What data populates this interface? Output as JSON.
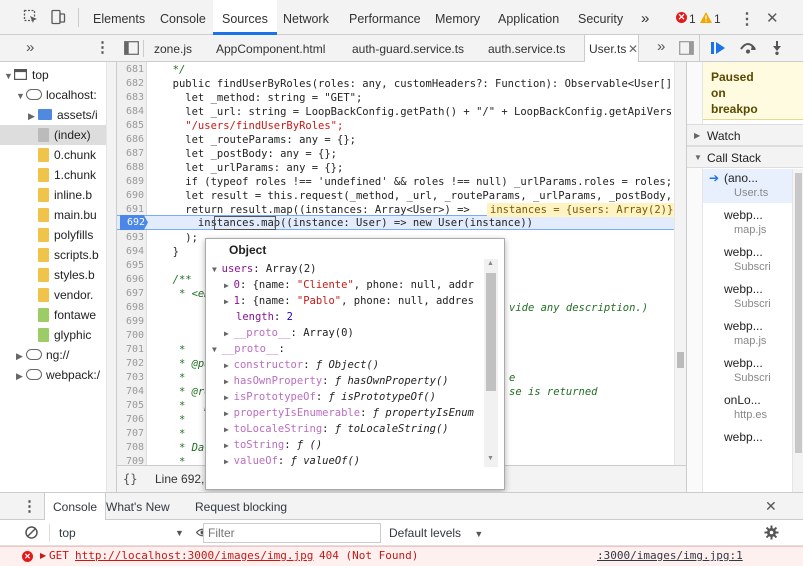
{
  "toolbar": {
    "tabs": [
      "Elements",
      "Console",
      "Sources",
      "Network",
      "Performance",
      "Memory",
      "Application",
      "Security"
    ],
    "more": "»",
    "errors_count": "1",
    "warnings_count": "1",
    "close": "✕"
  },
  "source_tabs": {
    "files": [
      "zone.js",
      "AppComponent.html",
      "auth-guard.service.ts",
      "auth.service.ts",
      "User.ts"
    ],
    "active": "User.ts",
    "nav_more": "»"
  },
  "navigator": {
    "items": [
      {
        "label": "top",
        "icon": "window-icon"
      },
      {
        "label": "localhost:",
        "icon": "cloud-icon"
      },
      {
        "label": "assets/i",
        "icon": "folder-icon"
      },
      {
        "label": "(index)",
        "icon": "file-icon"
      },
      {
        "label": "0.chunk",
        "icon": "file-icon"
      },
      {
        "label": "1.chunk",
        "icon": "file-icon"
      },
      {
        "label": "inline.b",
        "icon": "file-icon"
      },
      {
        "label": "main.bu",
        "icon": "file-icon"
      },
      {
        "label": "polyfills",
        "icon": "file-icon"
      },
      {
        "label": "scripts.b",
        "icon": "file-icon"
      },
      {
        "label": "styles.b",
        "icon": "file-icon"
      },
      {
        "label": "vendor.",
        "icon": "file-icon"
      },
      {
        "label": "fontawe",
        "icon": "file-icon"
      },
      {
        "label": "glyphic",
        "icon": "file-icon"
      },
      {
        "label": "ng://",
        "icon": "cloud-icon"
      },
      {
        "label": "webpack:/",
        "icon": "cloud-icon"
      }
    ]
  },
  "editor": {
    "lines": [
      {
        "num": "681",
        "text": "  */"
      },
      {
        "num": "682",
        "text": "  public findUserByRoles(roles: any, customHeaders?: Function): Observable<User[]"
      },
      {
        "num": "683",
        "text": "    let _method: string = \"GET\";"
      },
      {
        "num": "684",
        "text": "    let _url: string = LoopBackConfig.getPath() + \"/\" + LoopBackConfig.getApiVers"
      },
      {
        "num": "685",
        "text": "    \"/users/findUserByRoles\";"
      },
      {
        "num": "686",
        "text": "    let _routeParams: any = {};"
      },
      {
        "num": "687",
        "text": "    let _postBody: any = {};"
      },
      {
        "num": "688",
        "text": "    let _urlParams: any = {};"
      },
      {
        "num": "689",
        "text": "    if (typeof roles !== 'undefined' && roles !== null) _urlParams.roles = roles;"
      },
      {
        "num": "690",
        "text": "    let result = this.request(_method, _url, _routeParams, _urlParams, _postBody,"
      },
      {
        "num": "691",
        "text": "    return result.map((instances: Array<User>) =>"
      },
      {
        "num": "692",
        "text": "      instances.map((instance: User) => new User(instance))"
      },
      {
        "num": "693",
        "text": "    );"
      },
      {
        "num": "694",
        "text": "  }"
      },
      {
        "num": "695",
        "text": ""
      },
      {
        "num": "696",
        "text": "  /**"
      },
      {
        "num": "697",
        "text": "   * <em"
      },
      {
        "num": "698",
        "text": ""
      },
      {
        "num": "699",
        "text": ""
      },
      {
        "num": "700",
        "text": ""
      },
      {
        "num": "701",
        "text": "   *"
      },
      {
        "num": "702",
        "text": "   * @pa"
      },
      {
        "num": "703",
        "text": "   *"
      },
      {
        "num": "704",
        "text": "   * @re"
      },
      {
        "num": "705",
        "text": "   *   p"
      },
      {
        "num": "706",
        "text": "   *   f"
      },
      {
        "num": "707",
        "text": "   *"
      },
      {
        "num": "708",
        "text": "   * Dat"
      },
      {
        "num": "709",
        "text": "   *"
      }
    ],
    "inline_value": "instances = {users: Array(2)}",
    "comment_tail_698": "vide any description.)",
    "comment_tail_705": "e",
    "comment_tail_706": "se is returned",
    "status": "Line 692, C"
  },
  "popover": {
    "title": "Object",
    "lines": [
      "▼ users: Array(2)",
      "  ▶ 0: {name: \"Cliente\", phone: null, addr",
      "  ▶ 1: {name: \"Pablo\", phone: null, addres",
      "    length: 2",
      "  ▶ __proto__: Array(0)",
      "▼ __proto__:",
      "  ▶ constructor: ƒ Object()",
      "  ▶ hasOwnProperty: ƒ hasOwnProperty()",
      "  ▶ isPrototypeOf: ƒ isPrototypeOf()",
      "  ▶ propertyIsEnumerable: ƒ propertyIsEnum",
      "  ▶ toLocaleString: ƒ toLocaleString()",
      "  ▶ toString: ƒ ()",
      "  ▶ valueOf: ƒ valueOf()"
    ]
  },
  "debugger": {
    "paused_text": [
      "Paused",
      "on",
      "breakpo"
    ],
    "watch": "Watch",
    "call_stack": "Call Stack",
    "frames": [
      {
        "fn": "(ano...",
        "loc": "User.ts"
      },
      {
        "fn": "webp...",
        "loc": "map.js"
      },
      {
        "fn": "webp...",
        "loc": "Subscri"
      },
      {
        "fn": "webp...",
        "loc": "Subscri"
      },
      {
        "fn": "webp...",
        "loc": "map.js"
      },
      {
        "fn": "webp...",
        "loc": "Subscri"
      },
      {
        "fn": "onLo...",
        "loc": "http.es"
      },
      {
        "fn": "webp...",
        "loc": ""
      }
    ]
  },
  "drawer": {
    "tabs": [
      "Console",
      "What's New",
      "Request blocking"
    ],
    "context": "top",
    "filter_placeholder": "Filter",
    "levels": "Default levels",
    "error": {
      "method": "GET",
      "url": "http://localhost:3000/images/img.jpg",
      "status": "404 (Not Found)",
      "source": ":3000/images/img.jpg:1"
    }
  },
  "colors": {
    "accent": "#1a73e8",
    "error": "#e41a1a",
    "warning": "#f2a600",
    "paused_bg": "#fffbe0"
  }
}
